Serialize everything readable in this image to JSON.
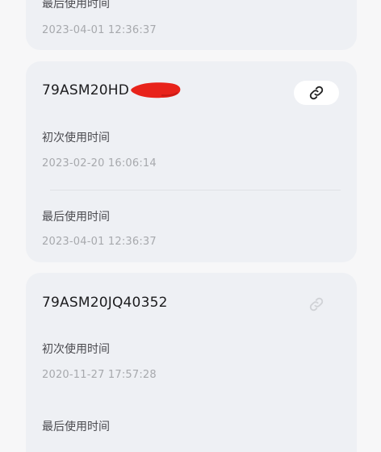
{
  "cards": [
    {
      "last_use_label": "最后使用时间",
      "last_use_value": "2023-04-01 12:36:37"
    },
    {
      "device_id": "79ASM20HD",
      "first_use_label": "初次使用时间",
      "first_use_value": "2023-02-20 16:06:14",
      "last_use_label": "最后使用时间",
      "last_use_value": "2023-04-01 12:36:37",
      "link_icon": "link-icon"
    },
    {
      "device_id": "79ASM20JQ40352",
      "first_use_label": "初次使用时间",
      "first_use_value": "2020-11-27 17:57:28",
      "last_use_label": "最后使用时间",
      "link_icon": "link-icon"
    }
  ],
  "colors": {
    "card_background": "#eef0f4",
    "page_background": "#f7f7f8",
    "redaction_mark": "#e8231b"
  }
}
